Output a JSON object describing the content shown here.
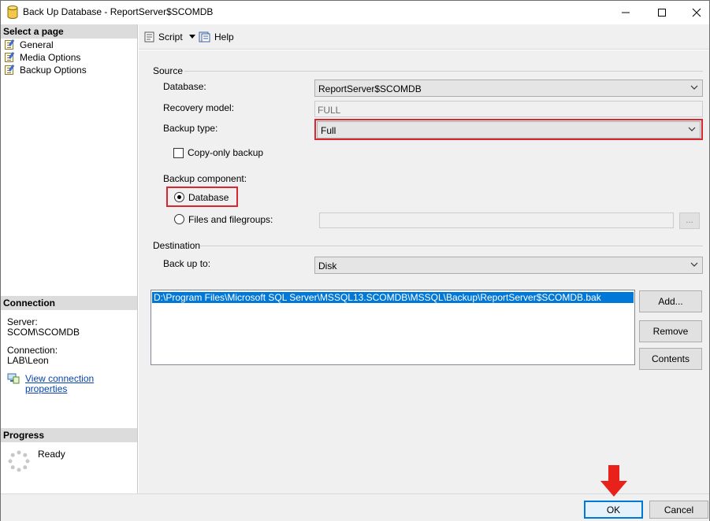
{
  "window": {
    "title": "Back Up Database - ReportServer$SCOMDB",
    "minimize": "—",
    "maximize": "☐",
    "close": "✕"
  },
  "left": {
    "select_page_header": "Select a page",
    "pages": [
      {
        "label": "General"
      },
      {
        "label": "Media Options"
      },
      {
        "label": "Backup Options"
      }
    ],
    "connection_header": "Connection",
    "server_label": "Server:",
    "server_value": "SCOM\\SCOMDB",
    "connection_label": "Connection:",
    "connection_value": "LAB\\Leon",
    "view_connection_link": "View connection properties",
    "progress_header": "Progress",
    "progress_status": "Ready"
  },
  "toolbar": {
    "script_label": "Script",
    "help_label": "Help"
  },
  "source": {
    "group_label": "Source",
    "database_label": "Database:",
    "database_value": "ReportServer$SCOMDB",
    "recovery_label": "Recovery model:",
    "recovery_value": "FULL",
    "backup_type_label": "Backup type:",
    "backup_type_value": "Full",
    "copy_only_label": "Copy-only backup",
    "component_label": "Backup component:",
    "component_database": "Database",
    "component_files": "Files and filegroups:",
    "browse_label": "..."
  },
  "destination": {
    "group_label": "Destination",
    "backup_to_label": "Back up to:",
    "backup_to_value": "Disk",
    "paths": [
      "D:\\Program Files\\Microsoft SQL Server\\MSSQL13.SCOMDB\\MSSQL\\Backup\\ReportServer$SCOMDB.bak"
    ],
    "add_label": "Add...",
    "remove_label": "Remove",
    "contents_label": "Contents"
  },
  "footer": {
    "ok_label": "OK",
    "cancel_label": "Cancel"
  },
  "colors": {
    "highlight": "#d9262f",
    "selection": "#0078d7",
    "arrow": "#e8221b"
  }
}
